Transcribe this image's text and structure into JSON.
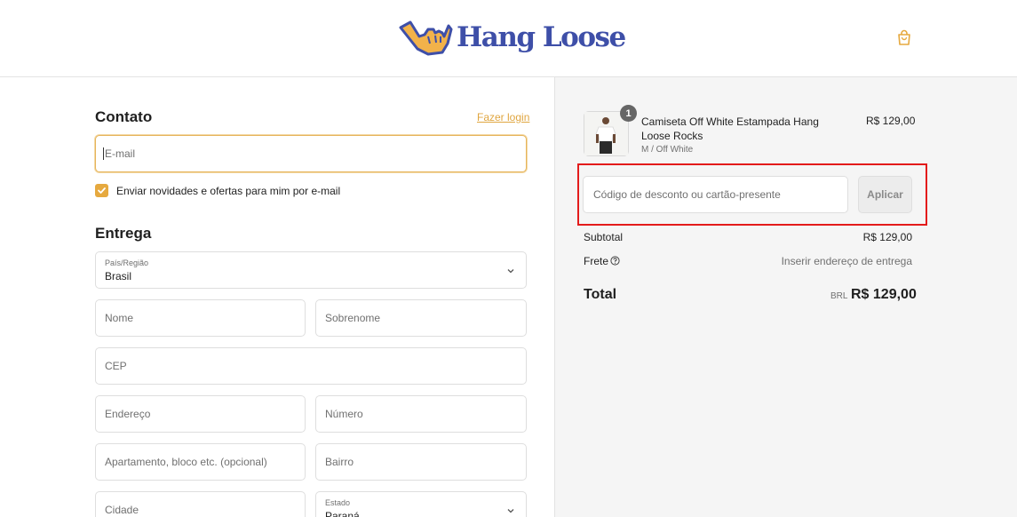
{
  "brand": {
    "name": "Hang Loose",
    "accent": "#e6a93f",
    "logo_blue": "#3e4fa8"
  },
  "header": {
    "cart_icon": "shopping-bag-icon"
  },
  "contact": {
    "title": "Contato",
    "login_link": "Fazer login",
    "email_placeholder": "E-mail",
    "newsletter_label": "Enviar novidades e ofertas para mim por e-mail",
    "newsletter_checked": true
  },
  "delivery": {
    "title": "Entrega",
    "country_label": "País/Região",
    "country_value": "Brasil",
    "first_name_placeholder": "Nome",
    "last_name_placeholder": "Sobrenome",
    "cep_placeholder": "CEP",
    "address_placeholder": "Endereço",
    "number_placeholder": "Número",
    "apartment_placeholder": "Apartamento, bloco etc. (opcional)",
    "neighborhood_placeholder": "Bairro",
    "city_placeholder": "Cidade",
    "state_label": "Estado",
    "state_value": "Paraná"
  },
  "summary": {
    "item": {
      "quantity": "1",
      "name": "Camiseta Off White Estampada Hang Loose Rocks",
      "variant": "M / Off White",
      "price": "R$ 129,00"
    },
    "discount_placeholder": "Código de desconto ou cartão-presente",
    "apply_label": "Aplicar",
    "subtotal_label": "Subtotal",
    "subtotal_value": "R$ 129,00",
    "shipping_label": "Frete",
    "shipping_value": "Inserir endereço de entrega",
    "total_label": "Total",
    "currency": "BRL",
    "total_value": "R$ 129,00"
  },
  "highlight_color": "#e31b1b"
}
